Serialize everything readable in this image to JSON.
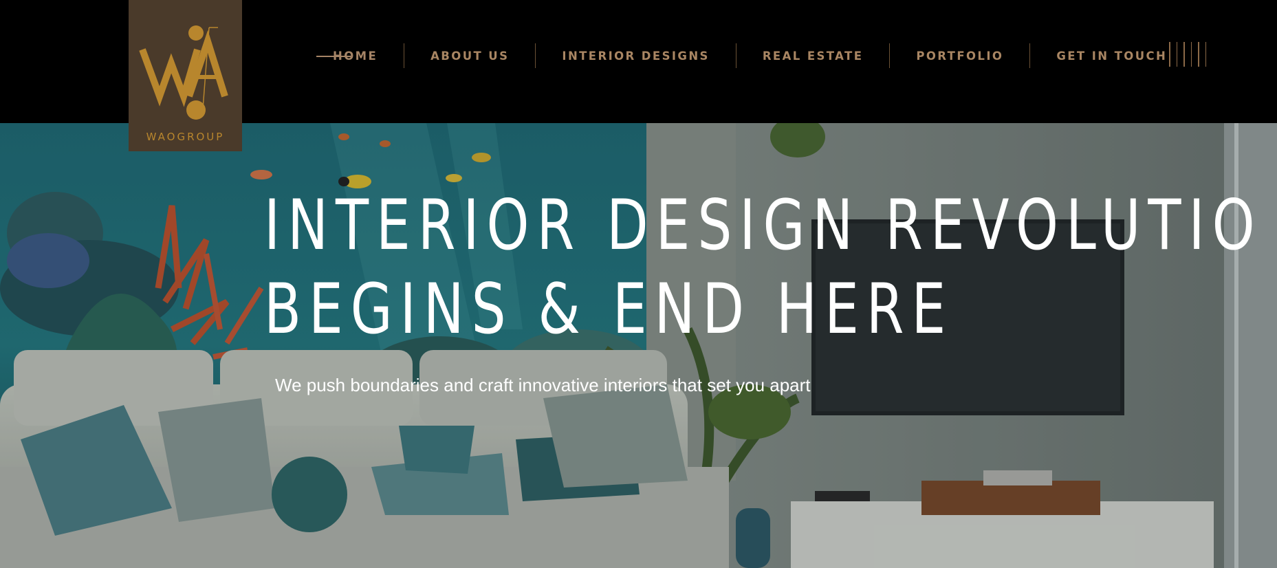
{
  "brand": {
    "logo_text": "WAOGROUP",
    "logo_colors": {
      "background": "#4a3a2a",
      "mark": "#b8862d"
    }
  },
  "nav": {
    "items": [
      {
        "label": "HOME",
        "active": true
      },
      {
        "label": "ABOUT US"
      },
      {
        "label": "INTERIOR DESIGNS"
      },
      {
        "label": "REAL ESTATE"
      },
      {
        "label": "PORTFOLIO"
      },
      {
        "label": "GET IN TOUCH"
      }
    ],
    "menu_icon": "vertical-lines-menu-icon"
  },
  "hero": {
    "title_line1": "INTERIOR DESIGN REVOLUTIO",
    "title_line2": "BEGINS & END HERE",
    "subtitle": "We push boundaries and craft innovative interiors that set you apart",
    "background_image": "living-room-with-aquarium-mural"
  },
  "colors": {
    "header_bg": "#000000",
    "nav_text": "#a98663",
    "hero_text": "#ffffff"
  }
}
